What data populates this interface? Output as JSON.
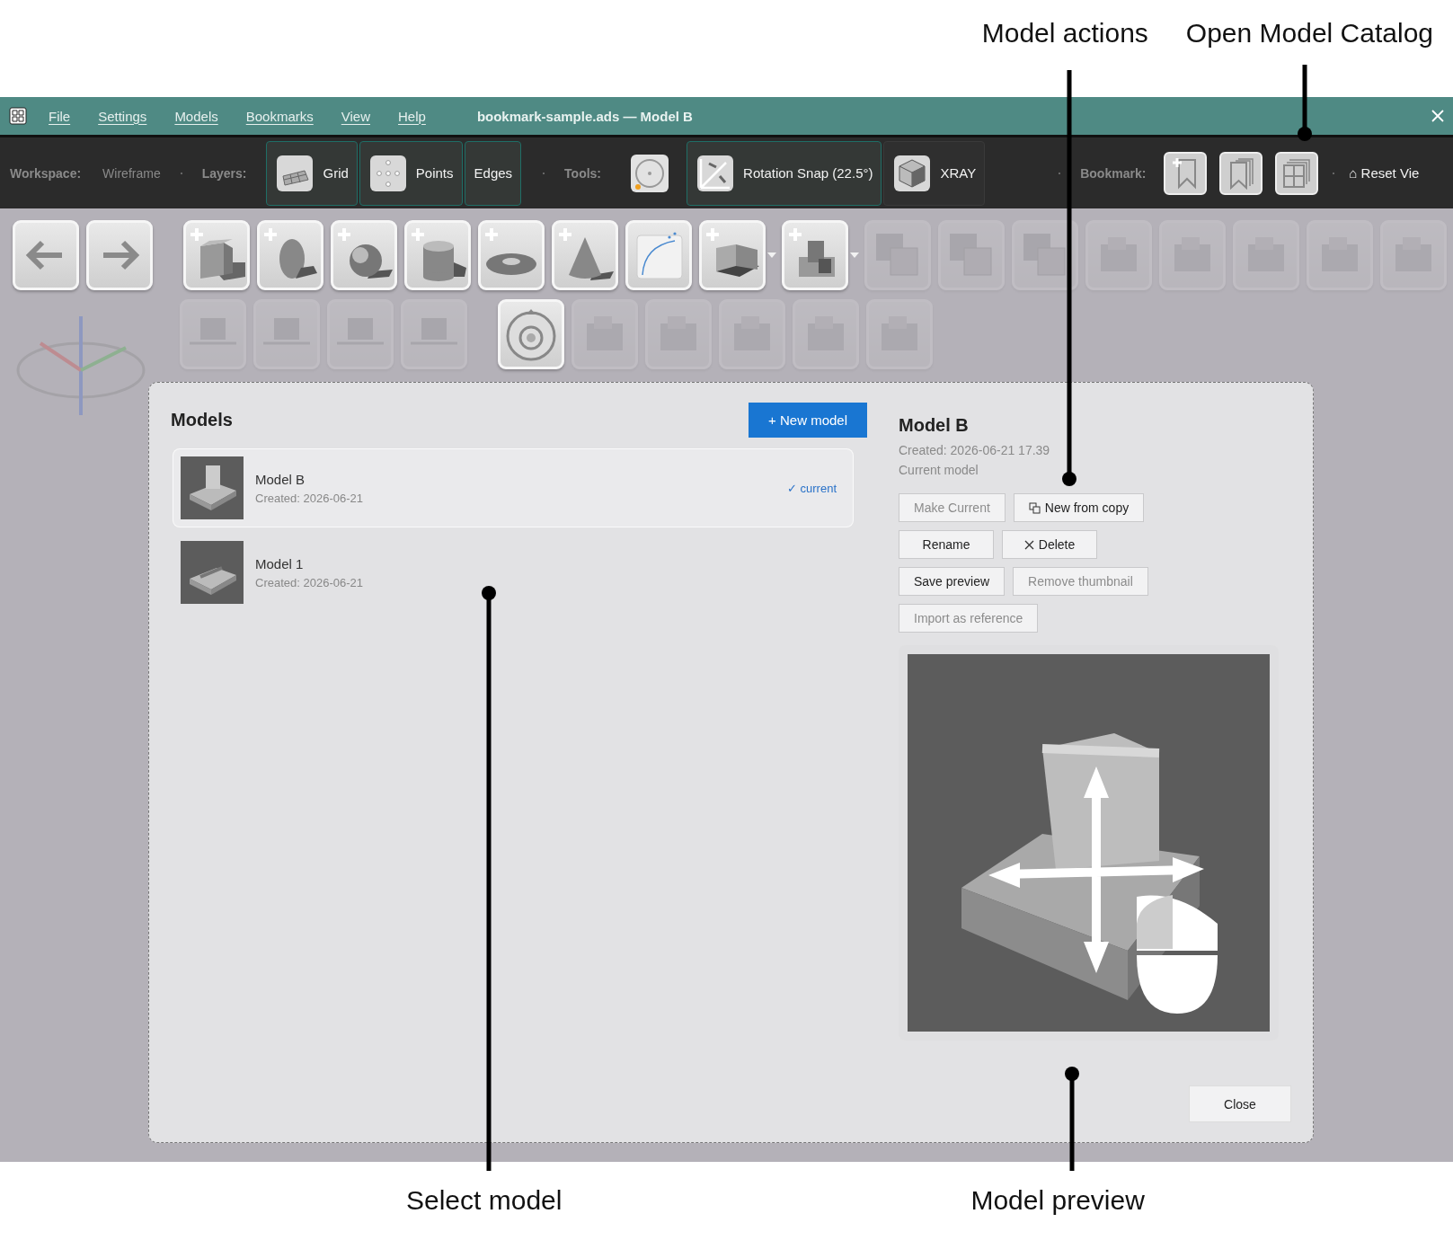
{
  "callouts_top": [
    "Model actions",
    "Open Model Catalog"
  ],
  "callouts_bottom": [
    "Select model",
    "Model preview"
  ],
  "window": {
    "title": "bookmark-sample.ads — Model B",
    "menu": [
      "File",
      "Settings",
      "Models",
      "Bookmarks",
      "View",
      "Help"
    ]
  },
  "toolbar": {
    "workspace_label": "Workspace:",
    "workspace_value": "Wireframe",
    "layers_label": "Layers:",
    "layers": [
      {
        "label": "Grid",
        "kind": "grid",
        "on": true
      },
      {
        "label": "Points",
        "kind": "points",
        "on": true
      },
      {
        "label": "Edges",
        "kind": "plain",
        "on": true
      }
    ],
    "tools_label": "Tools:",
    "tools": [
      {
        "kind": "orbit",
        "on": false
      },
      {
        "label": "Rotation Snap (22.5°)",
        "kind": "snap",
        "on": true
      },
      {
        "label": "XRAY",
        "kind": "xray",
        "on": false
      }
    ],
    "bookmark_label": "Bookmark:",
    "bookmarks": [
      {
        "kind": "add"
      },
      {
        "kind": "list"
      },
      {
        "kind": "catalog"
      }
    ],
    "reset_view": "⌂ Reset Vie"
  },
  "viewport": {
    "row_1": [
      [
        {
          "kind": "back",
          "disabled": false
        },
        {
          "kind": "forward",
          "disabled": false
        }
      ],
      [
        {
          "kind": "box",
          "disabled": false
        },
        {
          "kind": "ellipsoid",
          "disabled": false
        },
        {
          "kind": "sphere",
          "disabled": false
        },
        {
          "kind": "cylinder",
          "disabled": false
        },
        {
          "kind": "torus",
          "disabled": false
        },
        {
          "kind": "cone",
          "disabled": false
        },
        {
          "kind": "curve",
          "disabled": false
        },
        {
          "kind": "extrude",
          "disabled": false,
          "menu": true
        },
        {
          "kind": "combine",
          "disabled": false,
          "menu": true
        },
        {
          "kind": "union",
          "disabled": true
        },
        {
          "kind": "union",
          "disabled": true
        },
        {
          "kind": "union",
          "disabled": true
        },
        {
          "kind": "shape",
          "disabled": true
        },
        {
          "kind": "shape",
          "disabled": true
        },
        {
          "kind": "shape",
          "disabled": true
        },
        {
          "kind": "shape",
          "disabled": true
        },
        {
          "kind": "shape",
          "disabled": true
        }
      ]
    ],
    "row_2": [
      [
        {
          "kind": "align",
          "disabled": true
        },
        {
          "kind": "align",
          "disabled": true
        },
        {
          "kind": "align",
          "disabled": true
        },
        {
          "kind": "align",
          "disabled": true
        }
      ],
      [
        {
          "kind": "target",
          "disabled": false
        },
        {
          "kind": "shape",
          "disabled": true
        },
        {
          "kind": "shape",
          "disabled": true
        },
        {
          "kind": "shape",
          "disabled": true
        },
        {
          "kind": "shape",
          "disabled": true
        },
        {
          "kind": "shape",
          "disabled": true
        }
      ]
    ]
  },
  "dialog": {
    "title": "Models",
    "new_model": "+ New model",
    "models": [
      {
        "name": "Model B",
        "created": "Created: 2026-06-21",
        "badge": "✓ current",
        "selected": true
      },
      {
        "name": "Model 1",
        "created": "Created: 2026-06-21",
        "selected": false
      }
    ],
    "detail": {
      "title": "Model B",
      "created": "Created: 2026-06-21 17.39",
      "status": "Current model",
      "action_rows": [
        [
          {
            "label": "Make Current",
            "kind": "plain",
            "disabled": true
          },
          {
            "label": "New from copy",
            "kind": "copy",
            "disabled": false
          }
        ],
        [
          {
            "label": "Rename",
            "kind": "plain",
            "disabled": false
          },
          {
            "label": "Delete",
            "kind": "delete",
            "disabled": false
          }
        ],
        [
          {
            "label": "Save preview",
            "kind": "plain",
            "disabled": false
          },
          {
            "label": "Remove thumbnail",
            "kind": "plain",
            "disabled": true
          }
        ],
        [
          {
            "label": "Import as reference",
            "kind": "plain",
            "disabled": true
          }
        ]
      ]
    },
    "close": "Close"
  }
}
